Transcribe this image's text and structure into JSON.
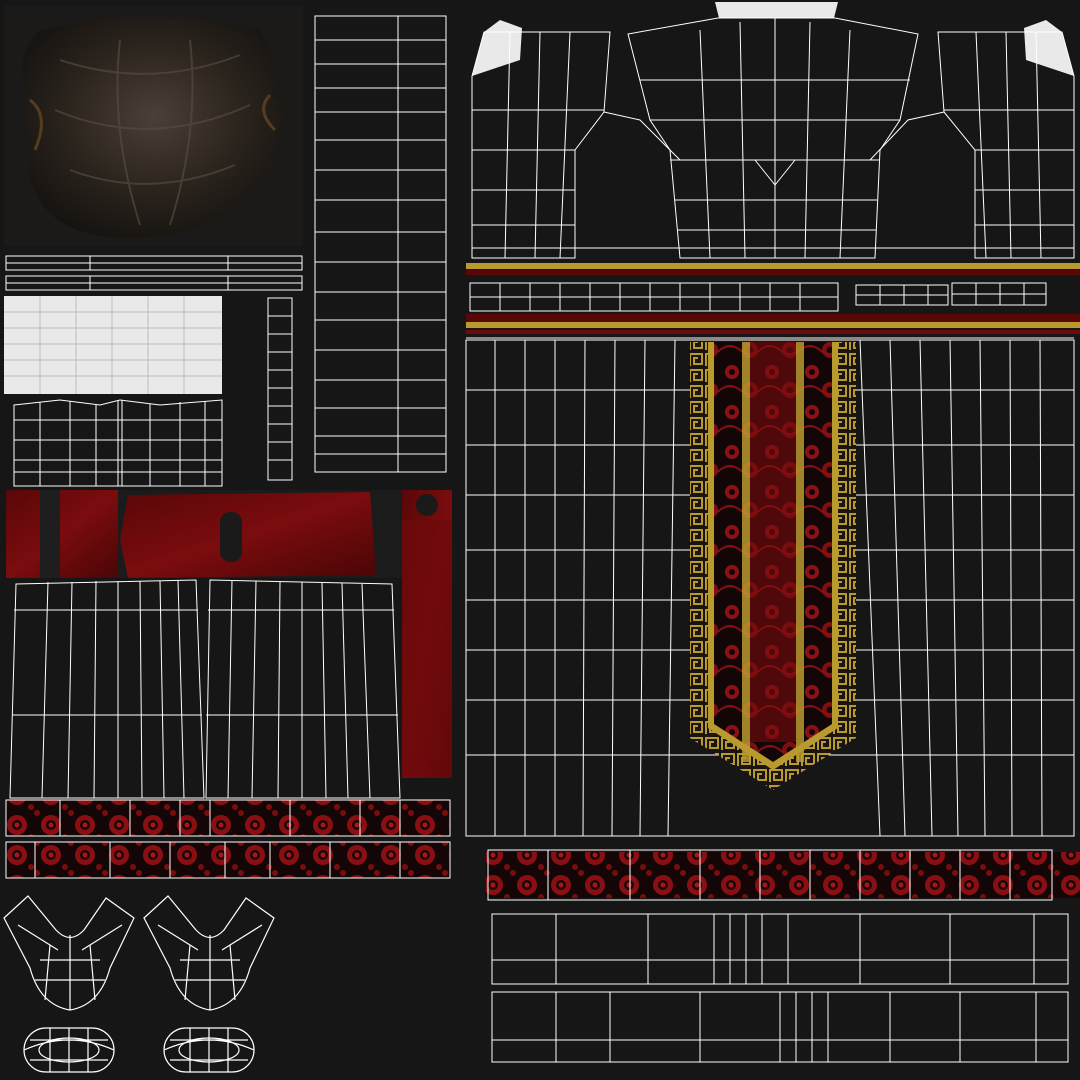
{
  "colors": {
    "background": "#161616",
    "panel": "#1c1c1c",
    "wire": "#ffffff",
    "red": "#7a0c0c",
    "deep_red": "#4a0507",
    "gold": "#b89a2e",
    "hair": "#2a221a",
    "light_patch": "#e9e9e9"
  },
  "islands": [
    {
      "name": "hair-texture",
      "kind": "texture"
    },
    {
      "name": "sleeve-lining",
      "kind": "wire-filled"
    },
    {
      "name": "robe-front",
      "kind": "wireframe"
    },
    {
      "name": "tie-panel",
      "kind": "patterned"
    },
    {
      "name": "trim-band",
      "kind": "patterned"
    },
    {
      "name": "shoe-uvs",
      "kind": "wireframe"
    }
  ]
}
